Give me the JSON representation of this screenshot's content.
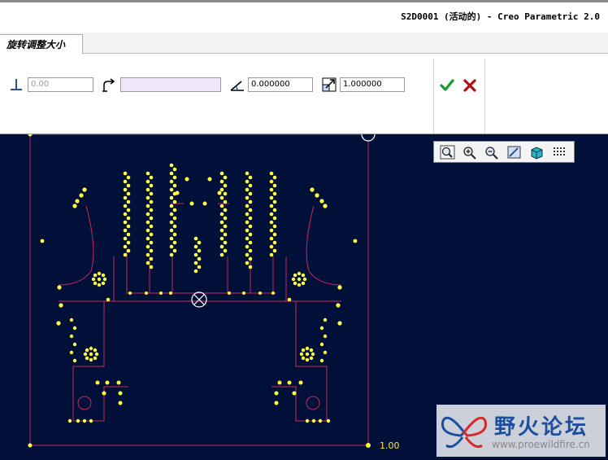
{
  "window": {
    "title": "S2D0001 (活动的) - Creo Parametric 2.0"
  },
  "tabs": [
    {
      "label": "旋转调整大小",
      "active": true
    }
  ],
  "dashboard": {
    "offset_value": "0.00",
    "reference_value": "",
    "rotation_angle": "0.000000",
    "scale_factor": "1.000000"
  },
  "canvas": {
    "scale_label": "1.00",
    "background": "#001038",
    "entity_color": "#ffff40",
    "outline_color": "#c8285a"
  },
  "view_toolbar": {
    "buttons": [
      "refit-icon",
      "zoom-in-icon",
      "zoom-out-icon",
      "repaint-icon",
      "display-style-icon",
      "sketcher-display-icon"
    ]
  },
  "watermark": {
    "text": "野火论坛",
    "url": "www.proewildfire.cn"
  }
}
